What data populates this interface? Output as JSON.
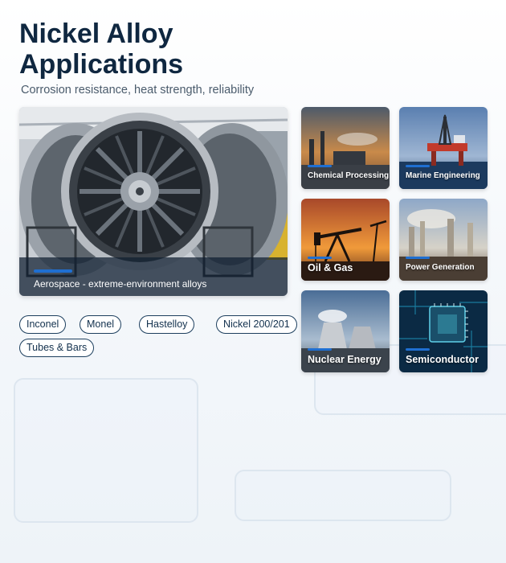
{
  "header": {
    "title": "Nickel Alloy Applications",
    "subtitle": "Corrosion resistance, heat strength, reliability"
  },
  "hero": {
    "label": "Aerospace - extreme-environment alloys",
    "icon": "jet-engine-image"
  },
  "tags": [
    "Inconel",
    "Monel",
    "Hastelloy",
    "Nickel 200/201",
    "Tubes & Bars"
  ],
  "tiles": [
    {
      "label": "Chemical Processing",
      "icon": "chemical-plant-image"
    },
    {
      "label": "Marine Engineering",
      "icon": "offshore-rig-image"
    },
    {
      "label": "Oil & Gas",
      "icon": "pumpjack-image"
    },
    {
      "label": "Power Generation",
      "icon": "power-plant-image"
    },
    {
      "label": "Nuclear Energy",
      "icon": "cooling-tower-image"
    },
    {
      "label": "Semiconductor",
      "icon": "microchip-image"
    }
  ],
  "colors": {
    "title": "#0f2740",
    "accent": "#1f6fd1",
    "tag_border": "#1d3f5e"
  }
}
